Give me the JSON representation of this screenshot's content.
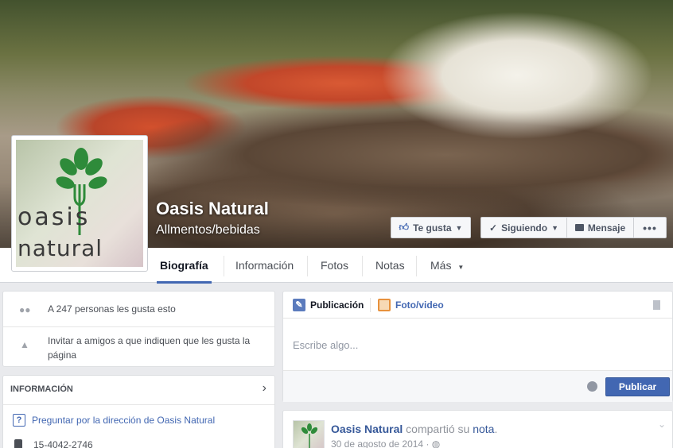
{
  "page": {
    "name": "Oasis Natural",
    "category": "Allmentos/bebidas"
  },
  "profile_logo": {
    "line1": "oasis",
    "line2": "natural"
  },
  "cover_buttons": {
    "like": "Te gusta",
    "following": "Siguiendo",
    "message": "Mensaje",
    "more": "•••"
  },
  "tabs": [
    {
      "label": "Biografía"
    },
    {
      "label": "Información"
    },
    {
      "label": "Fotos"
    },
    {
      "label": "Notas"
    },
    {
      "label": "Más"
    }
  ],
  "likes_box": {
    "likes_text": "A 247 personas les gusta esto",
    "invite_text": "Invitar a amigos a que indiquen que les gusta la página"
  },
  "info_box": {
    "title": "INFORMACIÓN",
    "directions_link": "Preguntar por la dirección de Oasis Natural",
    "phone": "15-4042-2746"
  },
  "composer": {
    "tab_post": "Publicación",
    "tab_photo": "Foto/video",
    "placeholder": "Escribe algo...",
    "publish": "Publicar"
  },
  "post": {
    "author": "Oasis Natural",
    "action": "compartió su",
    "object": "nota",
    "date": "30 de agosto de 2014"
  },
  "colors": {
    "fb_blue": "#4267b2",
    "logo_green": "#2e8b3a",
    "logo_text": "#3a3a3a"
  }
}
